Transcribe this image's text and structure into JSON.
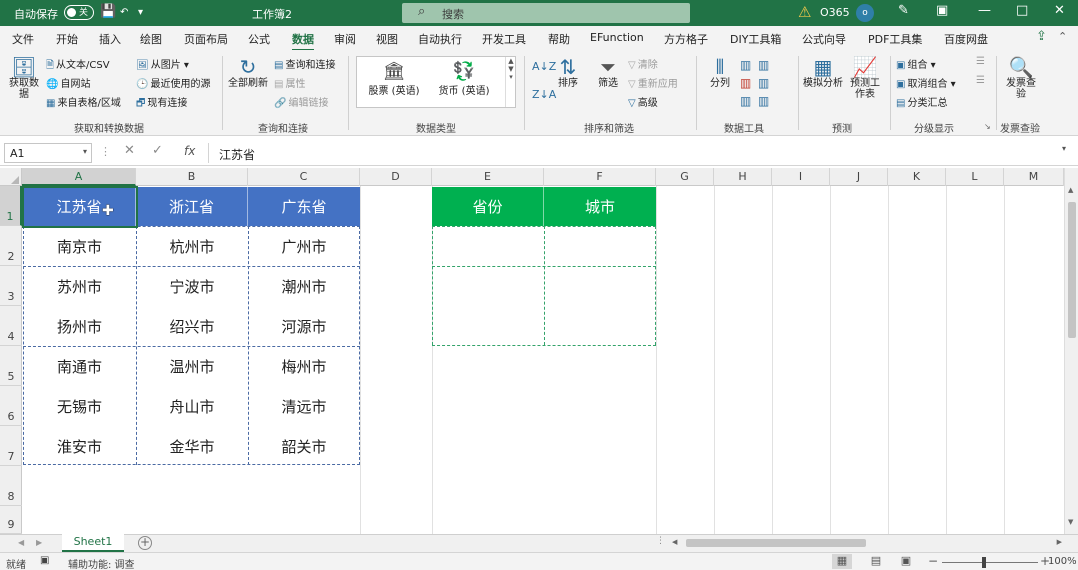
{
  "titlebar": {
    "autosave_label": "自动保存",
    "autosave_toggle": "关",
    "doc_title": "工作簿2",
    "search_placeholder": "搜索",
    "account": "O365"
  },
  "tabs": [
    "文件",
    "开始",
    "插入",
    "绘图",
    "页面布局",
    "公式",
    "数据",
    "审阅",
    "视图",
    "自动执行",
    "开发工具",
    "帮助",
    "EFunction",
    "方方格子",
    "DIY工具箱",
    "公式向导",
    "PDF工具集",
    "百度网盘"
  ],
  "active_tab": "数据",
  "ribbon": {
    "get_data": {
      "button": "获取数据",
      "small": [
        "从文本/CSV",
        "自网站",
        "来自表格/区域",
        "从图片",
        "最近使用的源",
        "现有连接"
      ],
      "label": "获取和转换数据"
    },
    "queries": {
      "button": "全部刷新",
      "small": [
        "查询和连接",
        "属性",
        "编辑链接"
      ],
      "label": "查询和连接"
    },
    "datatypes": {
      "items": [
        "股票 (英语)",
        "货币 (英语)"
      ],
      "label": "数据类型"
    },
    "sort": {
      "buttons": [
        "排序",
        "筛选"
      ],
      "small": [
        "清除",
        "重新应用",
        "高级"
      ],
      "label": "排序和筛选"
    },
    "tools": {
      "buttons": [
        "分列"
      ],
      "label": "数据工具"
    },
    "forecast": {
      "buttons": [
        "模拟分析",
        "预测工作表"
      ],
      "label": "预测"
    },
    "outline": {
      "small": [
        "组合",
        "取消组合",
        "分类汇总"
      ],
      "label": "分级显示"
    },
    "invoice": {
      "button": "发票查验",
      "label": "发票查验"
    }
  },
  "formula_bar": {
    "name_box": "A1",
    "fx": "fx",
    "content": "江苏省"
  },
  "columns": [
    "A",
    "B",
    "C",
    "D",
    "E",
    "F",
    "G",
    "H",
    "I",
    "J",
    "K",
    "L",
    "M"
  ],
  "rows": [
    "1",
    "2",
    "3",
    "4",
    "5",
    "6",
    "7",
    "8",
    "9"
  ],
  "table1": {
    "headers": [
      "江苏省",
      "浙江省",
      "广东省"
    ],
    "rows": [
      [
        "南京市",
        "杭州市",
        "广州市"
      ],
      [
        "苏州市",
        "宁波市",
        "潮州市"
      ],
      [
        "扬州市",
        "绍兴市",
        "河源市"
      ],
      [
        "南通市",
        "温州市",
        "梅州市"
      ],
      [
        "无锡市",
        "舟山市",
        "清远市"
      ],
      [
        "淮安市",
        "金华市",
        "韶关市"
      ]
    ]
  },
  "table2": {
    "headers": [
      "省份",
      "城市"
    ]
  },
  "sheets": [
    "Sheet1"
  ],
  "status": {
    "ready": "就绪",
    "accessibility": "辅助功能: 调查",
    "zoom": "100%"
  }
}
